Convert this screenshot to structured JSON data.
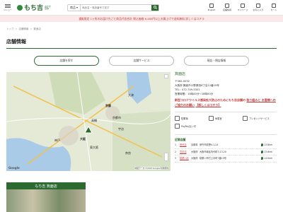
{
  "header": {
    "menu_label": "メニュー",
    "logo_text": "もち吉",
    "logo_sub": "おかき 煎餅",
    "search_category": "商品",
    "search_placeholder": "商品名・商品番号で探す",
    "icons": [
      {
        "name": "english-icon",
        "label": "English"
      },
      {
        "name": "store-icon",
        "label": "店舗情報"
      },
      {
        "name": "user-icon",
        "label": "マイページ"
      },
      {
        "name": "heart-icon",
        "label": "お気に入り"
      },
      {
        "name": "cart-icon",
        "label": "カート"
      }
    ]
  },
  "notice": "通販限定 1ヶ所のお届け先ごと商品代金合計 税込価格 6,480円以上お買上げで送料無料 詳しくはコチラ",
  "breadcrumb": [
    "トップ",
    "店舗情報",
    "箕面店"
  ],
  "page_title": "店舗情報",
  "tabs": [
    {
      "label": "店舗を探す",
      "active": true
    },
    {
      "label": "店舗サービス",
      "active": false
    },
    {
      "label": "現店・閉店情報",
      "active": false
    }
  ],
  "map": {
    "labels": [
      "京都",
      "大津",
      "大阪",
      "神戸",
      "奈良",
      "東大阪",
      "高槻",
      "京都市",
      "宇治"
    ],
    "footer": "地図データ ©2023 Google 利用規約",
    "google": "Google"
  },
  "store": {
    "name": "箕面店",
    "postal": "〒562-0032",
    "address": "大阪府 箕面市小野原西6丁目12番19号",
    "tel": "TEL：072-749-5301",
    "hours": "営業時間：10時00分～18時00分",
    "covid_1": "新型コロナウイルス感染拡大防止のためにもち吉店舗の",
    "covid_2": "取り組みと お客様へのご協力のお願い",
    "covid_link": "【詳しくはコチラ】",
    "facilities": [
      {
        "icon": "parking-icon",
        "label": "駐車場"
      },
      {
        "icon": "rest-area-icon",
        "label": "休憩室"
      },
      {
        "icon": "present-icon",
        "label": "プレゼントサービス"
      },
      {
        "icon": "paypay-icon",
        "label": "PayPay払い可"
      }
    ],
    "nearby_heading": "近隣店舗",
    "nearby": [
      {
        "num": "1",
        "name": "伊丹店",
        "pref": "兵庫県",
        "addr": "伊丹市荻野4-1-24",
        "dist": "13.6km"
      },
      {
        "num": "2",
        "name": "豊中店",
        "pref": "大阪府",
        "addr": "大阪市南区内代町3-13-20",
        "dist": "13.6km"
      },
      {
        "num": "3",
        "name": "寝屋川店",
        "pref": "大阪府",
        "addr": "寝屋川市打上中町7番15号",
        "dist": "14.0km"
      }
    ]
  },
  "photo_sign": "もち吉 箕面店"
}
